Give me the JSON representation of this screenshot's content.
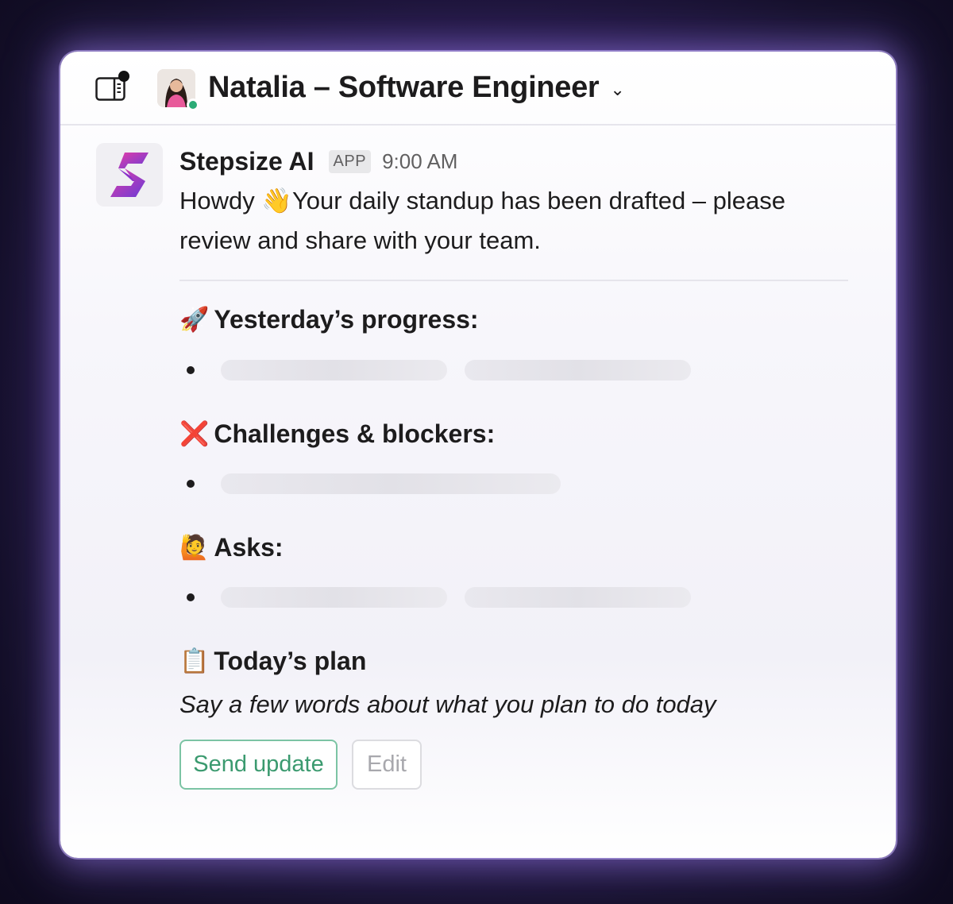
{
  "header": {
    "title": "Natalia – Software Engineer"
  },
  "message": {
    "sender": "Stepsize AI",
    "app_badge": "APP",
    "time": "9:00 AM",
    "intro": "Howdy 👋Your daily standup has been drafted – please review and share with your team."
  },
  "sections": {
    "yesterday": {
      "emoji": "🚀",
      "title": "Yesterday’s progress:"
    },
    "challenges": {
      "emoji": "❌",
      "title": "Challenges & blockers:"
    },
    "asks": {
      "emoji": "🙋",
      "title": "Asks:"
    },
    "today": {
      "emoji": "📋",
      "title": "Today’s plan",
      "placeholder": "Say a few words about what you plan to do today"
    }
  },
  "buttons": {
    "send": "Send update",
    "edit": "Edit"
  },
  "colors": {
    "presence": "#2bac76",
    "send_button": "#3b9a6f",
    "background": "#241847"
  }
}
